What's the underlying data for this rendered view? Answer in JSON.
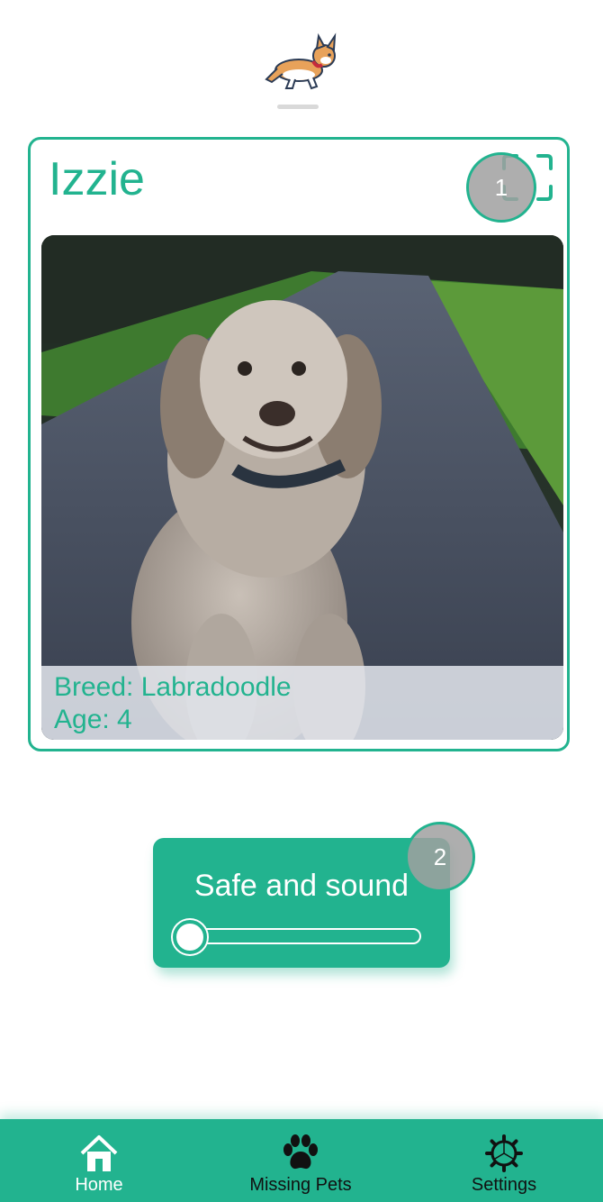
{
  "pet": {
    "name": "Izzie",
    "breed_line": "Breed: Labradoodle",
    "age_line": "Age: 4"
  },
  "annotations": {
    "badge_1": "1",
    "badge_2": "2"
  },
  "status": {
    "label": "Safe and sound",
    "slider_value": 0
  },
  "tabs": [
    {
      "label": "Home",
      "icon": "home-icon",
      "active": true
    },
    {
      "label": "Missing Pets",
      "icon": "paw-icon",
      "active": false
    },
    {
      "label": "Settings",
      "icon": "gear-icon",
      "active": false
    }
  ],
  "colors": {
    "accent": "#22b38f",
    "badge": "#a0a0a0",
    "overlay": "#e4e7ee"
  }
}
